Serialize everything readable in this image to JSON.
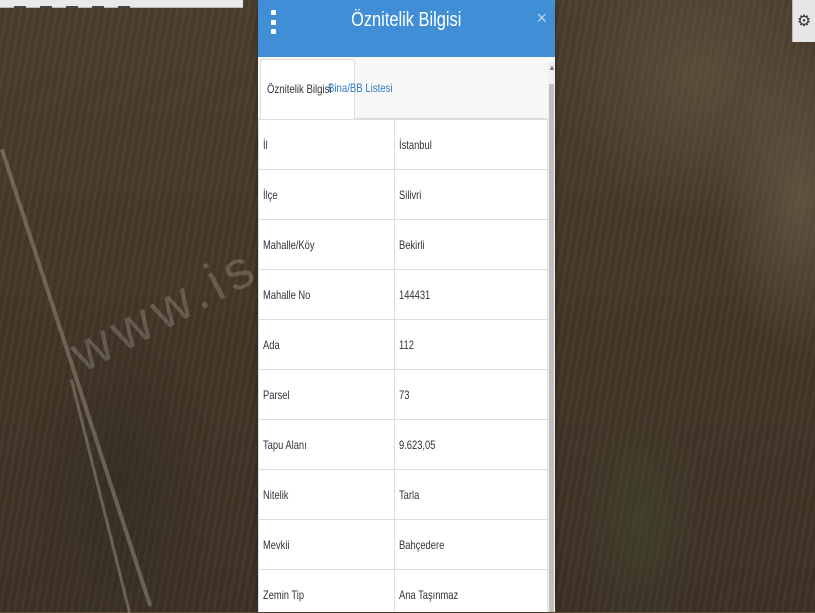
{
  "panel": {
    "title": "Öznitelik Bilgisi",
    "close": "×"
  },
  "tabs": [
    {
      "label": "Öznitelik Bilgisi",
      "active": true
    },
    {
      "label": "Bina/BB Listesi",
      "active": false
    }
  ],
  "rows": [
    {
      "key": "İl",
      "value": "İstanbul"
    },
    {
      "key": "İlçe",
      "value": "Silivri"
    },
    {
      "key": "Mahalle/Köy",
      "value": "Bekirli"
    },
    {
      "key": "Mahalle No",
      "value": "144431"
    },
    {
      "key": "Ada",
      "value": "112"
    },
    {
      "key": "Parsel",
      "value": "73"
    },
    {
      "key": "Tapu Alanı",
      "value": "9.623,05"
    },
    {
      "key": "Nitelik",
      "value": "Tarla"
    },
    {
      "key": "Mevkii",
      "value": "Bahçedere"
    },
    {
      "key": "Zemin Tip",
      "value": "Ana Taşınmaz"
    }
  ],
  "watermark": "www.is          .com.tr",
  "icons": {
    "menu": "vertical-dots-icon",
    "close": "close-icon",
    "settings": "gear-icon",
    "scroll_up": "scroll-up-arrow-icon"
  },
  "colors": {
    "header": "#3f8ed6",
    "tab_link": "#2e7bc4"
  }
}
